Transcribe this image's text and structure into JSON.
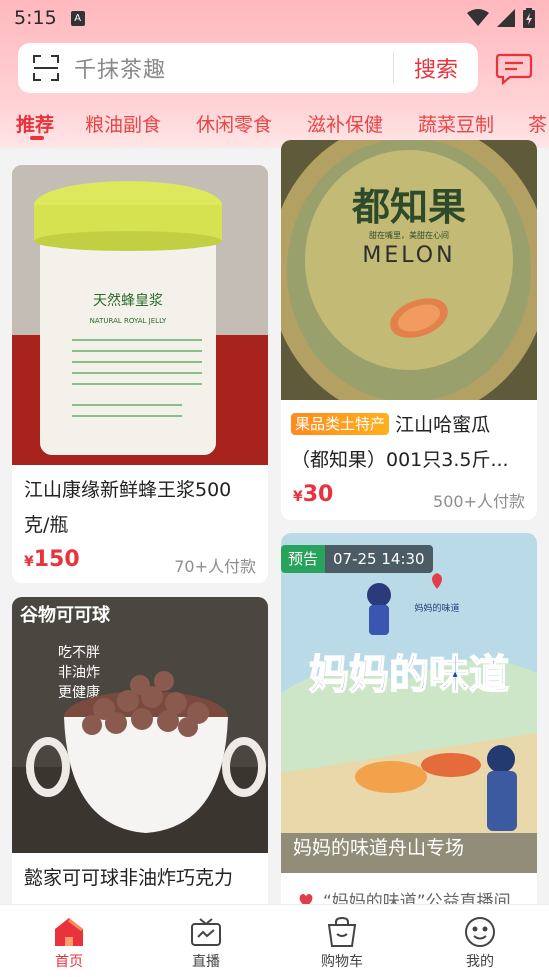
{
  "status_bar": {
    "time": "5:15",
    "indicator": "A"
  },
  "search": {
    "placeholder": "千抹茶趣",
    "button": "搜索"
  },
  "tabs": [
    "推荐",
    "粮油副食",
    "休闲零食",
    "滋补保健",
    "蔬菜豆制",
    "茶"
  ],
  "products": {
    "p1": {
      "name_line1": "江山康缘新鲜蜂王浆500",
      "name_line2": "克/瓶",
      "yen": "¥",
      "price": "150",
      "sales": "70+人付款",
      "img_label": "天然蜂皇浆",
      "img_sub": "NATURAL ROYAL JELLY"
    },
    "p2": {
      "badge": "果品类土特产",
      "name_line1": "江山哈蜜瓜",
      "name_line2": "（都知果）001只3.5斤...",
      "yen": "¥",
      "price": "30",
      "sales": "500+人付款",
      "img_brand": "都知果",
      "img_melon": "MELON",
      "img_slogan": "甜在嘴里，美甜在心间"
    },
    "p3": {
      "name_line1": "懿家可可球非油炸巧克力",
      "img_title": "谷物可可球",
      "img_points": [
        "吃不胖",
        "非油炸",
        "更健康"
      ]
    },
    "p4": {
      "pre": "预告",
      "time": "07-25 14:30",
      "img_title": "妈妈的味道",
      "logo_text": "妈妈的味道",
      "caption": "妈妈的味道舟山专场",
      "desc": "“妈妈的味道”公益直播间"
    }
  },
  "nav": [
    {
      "label": "首页",
      "icon": "home-icon",
      "active": true
    },
    {
      "label": "直播",
      "icon": "tv-icon",
      "active": false
    },
    {
      "label": "购物车",
      "icon": "cart-icon",
      "active": false
    },
    {
      "label": "我的",
      "icon": "smile-icon",
      "active": false
    }
  ],
  "colors": {
    "accent": "#e8323c",
    "header_bg": "#ffc6ca",
    "badge_orange": "#ff9a1f",
    "preview_green": "#27a35c"
  }
}
